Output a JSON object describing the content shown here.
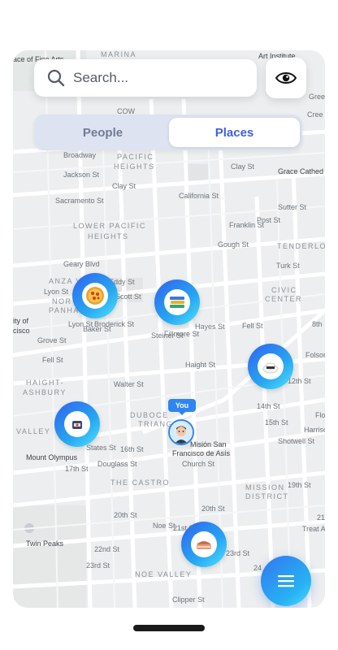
{
  "search": {
    "placeholder": "Search..."
  },
  "tabs": [
    {
      "label": "People",
      "active": false
    },
    {
      "label": "Places",
      "active": true
    }
  ],
  "user_marker": {
    "label": "You"
  },
  "map": {
    "areas": [
      "MARINA",
      "PACIFIC",
      "HEIGHTS",
      "LOWER PACIFIC",
      "HEIGHTS",
      "TENDERLOI",
      "ANZA V",
      "NOR",
      "PANHA",
      "CIVIC",
      "CENTER",
      "HAIGHT-",
      "ASHBURY",
      "VALLEY",
      "DUBOCE",
      "TRIANG",
      "THE CASTRO",
      "MISSION",
      "DISTRICT",
      "NOE VALLEY"
    ],
    "streets": [
      "Broadway",
      "Jackson St",
      "Clay St",
      "Clay St",
      "California St",
      "Sacramento St",
      "Sutter St",
      "Post St",
      "Geary Blvd",
      "Turk St",
      "Eddy St",
      "Scott St",
      "Hayes St",
      "Fell St",
      "Fell St",
      "Grove St",
      "Lyon St",
      "Baker St",
      "Broderick St",
      "Steiner St",
      "Fillmore St",
      "Haight St",
      "Walter St",
      "Gough St",
      "Franklin St",
      "16th St",
      "17th St",
      "14th St",
      "15th St",
      "19th St",
      "20th St",
      "21st St",
      "22nd St",
      "23rd St",
      "20th St",
      "Clipper St",
      "Church St",
      "Noe St",
      "Douglass St",
      "Shotwell St",
      "Harrison St",
      "Treat Ave",
      "Folsom",
      "Lyon St",
      "COW",
      "8th",
      "12th St",
      "States St",
      "24",
      "21",
      "23rd St",
      "Cree",
      "Florida St",
      "Green"
    ],
    "places": [
      "Art Institute",
      "Grace Cathed",
      "Mount Olympus",
      "Misión San",
      "Francisco de Asís",
      "Twin Peaks",
      "ity of",
      "cisco",
      "ace of Fine Arts"
    ]
  },
  "markers": [
    {
      "name": "pizza-place",
      "icon": "pizza-icon"
    },
    {
      "name": "bookstore-place",
      "icon": "books-icon"
    },
    {
      "name": "sushi-place",
      "icon": "sushi-icon"
    },
    {
      "name": "noodle-place",
      "icon": "ramen-icon"
    },
    {
      "name": "dessert-place",
      "icon": "cake-icon"
    }
  ],
  "colors": {
    "accent": "#3f5fe0",
    "segment_bg": "#dde3f1",
    "marker_gradient_start": "#2f62ee",
    "marker_gradient_end": "#4fe3ff"
  }
}
